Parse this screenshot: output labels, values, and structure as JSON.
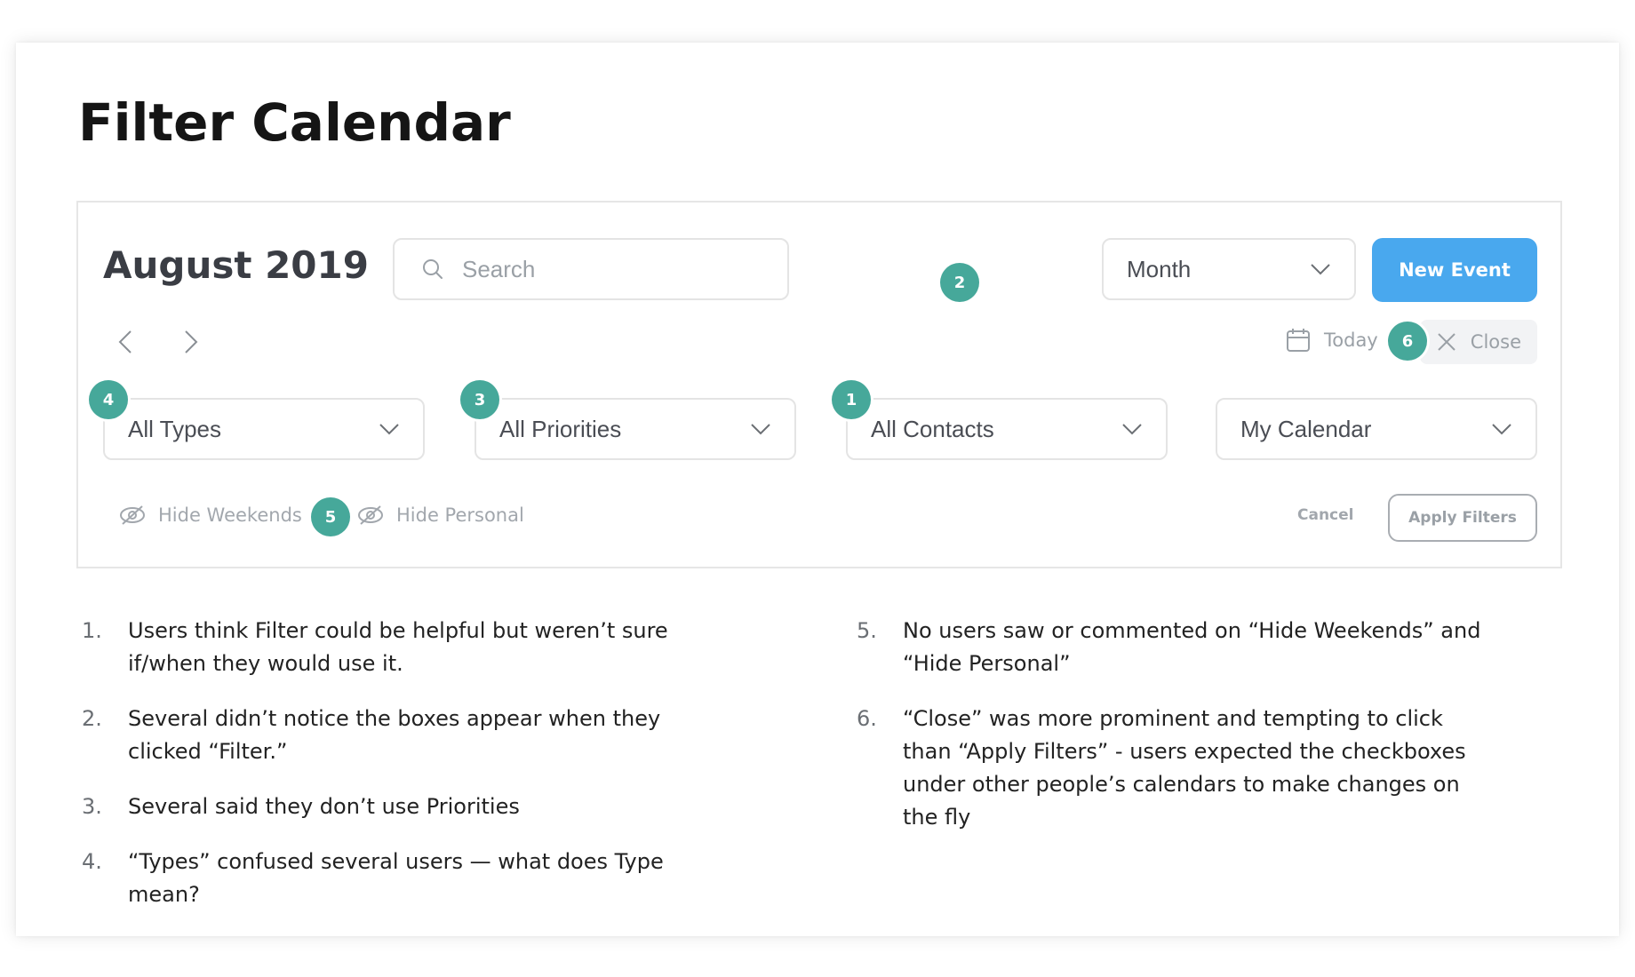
{
  "page": {
    "title": "Filter Calendar"
  },
  "calendar": {
    "month_label": "August 2019",
    "search": {
      "placeholder": "Search"
    },
    "view_select": "Month",
    "new_event_label": "New Event",
    "today_label": "Today",
    "close_label": "Close"
  },
  "filters": {
    "types": "All Types",
    "priorities": "All Priorities",
    "contacts": "All Contacts",
    "calendar": "My Calendar",
    "hide_weekends_label": "Hide Weekends",
    "hide_personal_label": "Hide Personal",
    "cancel_label": "Cancel",
    "apply_label": "Apply Filters"
  },
  "badges": [
    "1",
    "2",
    "3",
    "4",
    "5",
    "6"
  ],
  "notes": [
    {
      "num": "1.",
      "text": "Users think Filter could be helpful but weren’t sure if/when they would use it."
    },
    {
      "num": "2.",
      "text": "Several didn’t notice the boxes appear when they clicked “Filter.”"
    },
    {
      "num": "3.",
      "text": "Several said they don’t use Priorities"
    },
    {
      "num": "4.",
      "text": "“Types” confused several users — what does Type mean?"
    },
    {
      "num": "5.",
      "text": "No users saw or commented on “Hide Weekends” and “Hide Personal”"
    },
    {
      "num": "6.",
      "text": "“Close” was more prominent and tempting to click than “Apply Filters” - users expected the checkboxes under other people’s calendars to make changes on the fly"
    }
  ],
  "colors": {
    "accent_blue": "#49a8ee",
    "badge_teal": "#46a89a"
  }
}
